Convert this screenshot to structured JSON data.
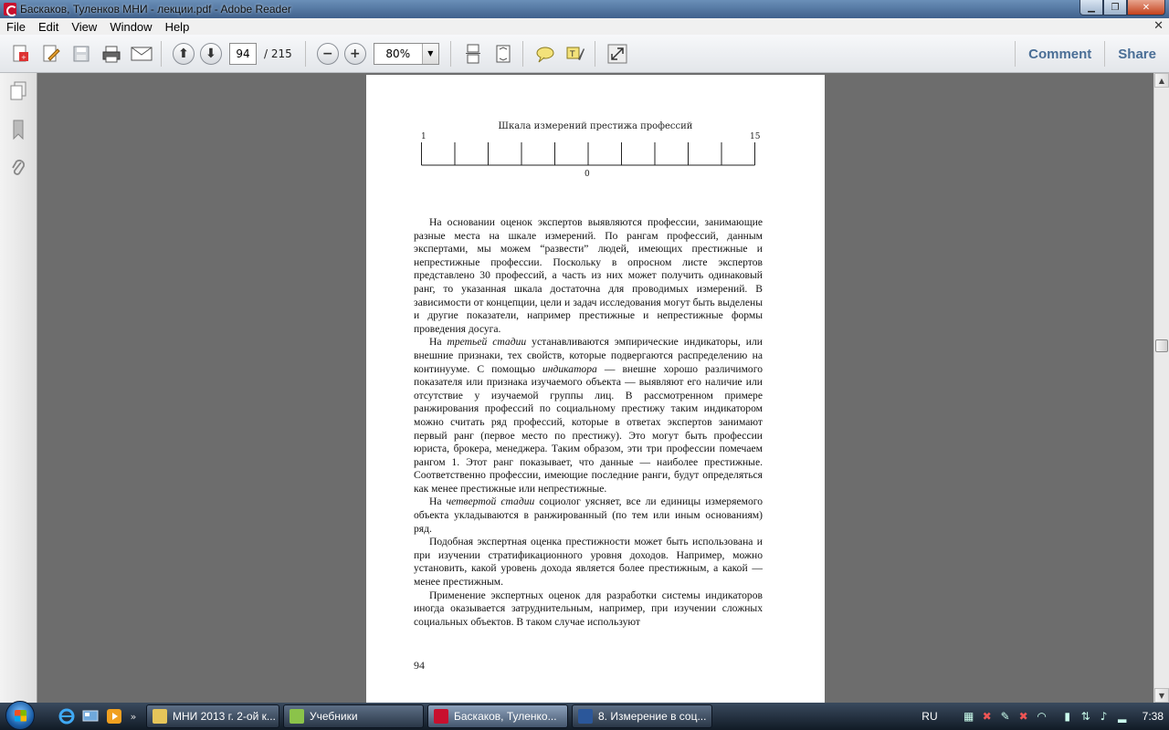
{
  "window": {
    "title": "Баскаков, Туленков МНИ - лекции.pdf - Adobe Reader"
  },
  "menu": {
    "items": [
      "File",
      "Edit",
      "View",
      "Window",
      "Help"
    ]
  },
  "toolbar": {
    "page_current": "94",
    "page_total": "/ 215",
    "zoom": "80%",
    "comment": "Comment",
    "share": "Share"
  },
  "document": {
    "scale_title": "Шкала измерений престижа профессий",
    "scale_left_label": "1",
    "scale_right_label": "15",
    "scale_center_label": "0",
    "paragraphs": [
      "На основании оценок экспертов выявляются профессии, занимающие разные места на шкале измерений. По рангам профессий, данным экспертами, мы можем “развести” людей, имеющих престижные и непрестижные профессии. Поскольку в опросном листе экспертов представлено 30 профессий, а часть из них может получить одинаковый ранг, то указанная шкала достаточна для проводимых измерений. В зависимости от концепции, цели и задач исследования могут быть выделены и другие показатели, например престижные и непрестижные формы проведения досуга.",
      "Подобная экспертная оценка престижности может быть использована и при изучении стратификационного уровня доходов. Например, можно установить, какой уровень дохода является более престижным, а какой — менее престижным.",
      "Применение экспертных оценок для разработки системы индикаторов иногда оказывается затруднительным, например, при изучении сложных социальных объектов. В таком случае используют"
    ],
    "p2": {
      "a": "На ",
      "em1": "третьей стадии",
      "b": " устанавливаются эмпирические индикаторы, или внешние признаки, тех свойств, которые подвергаются распределению на континууме. С помощью ",
      "em2": "индикатора",
      "c": " — внешне хорошо различимого показателя или признака изучаемого объекта — выявляют его наличие или отсутствие у изучаемой группы лиц. В рассмотренном примере ранжирования профессий по социальному престижу таким индикатором можно считать ряд профессий, которые в ответах экспертов занимают первый ранг (первое место по престижу). Это могут быть профессии юриста, брокера, менеджера. Таким образом, эти три профессии помечаем рангом 1. Этот ранг показывает, что данные — наиболее престижные. Соответственно профессии, имеющие последние ранги, будут определяться как менее престижные или непрестижные."
    },
    "p3": {
      "a": "На ",
      "em1": "четвертой стадии",
      "b": " социолог уясняет, все ли единицы измеряемого объекта укладываются в ранжированный (по тем или иным основаниям) ряд."
    },
    "page_number": "94"
  },
  "taskbar": {
    "tasks": [
      "МНИ 2013 г. 2-ой к...",
      "Учебники",
      "Баскаков, Туленко...",
      "8. Измерение в соц..."
    ],
    "language": "RU",
    "clock": "7:38"
  }
}
